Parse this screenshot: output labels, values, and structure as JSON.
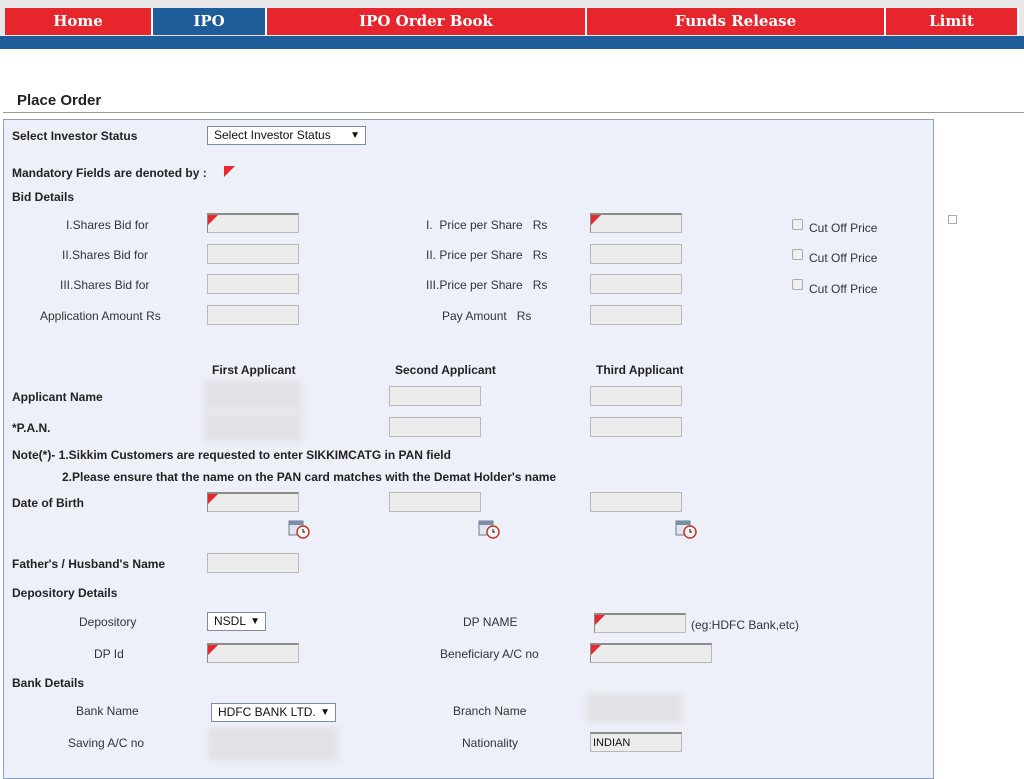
{
  "nav": {
    "items": [
      {
        "label": "Home"
      },
      {
        "label": "IPO"
      },
      {
        "label": "IPO Order Book"
      },
      {
        "label": "Funds Release"
      },
      {
        "label": "Limit"
      }
    ]
  },
  "page": {
    "title": "Place Order"
  },
  "form": {
    "investor_status_label": "Select Investor Status",
    "investor_status_value": "Select Investor Status",
    "mandatory_note": "Mandatory Fields are denoted by :",
    "bid_details": {
      "heading": "Bid Details",
      "shares_bid_1": "I.Shares Bid for",
      "shares_bid_2": "II.Shares Bid for",
      "shares_bid_3": "III.Shares Bid for",
      "application_amount": "Application Amount   Rs",
      "price_1": "I.  Price per Share   Rs",
      "price_2": "II. Price per Share   Rs",
      "price_3": "III.Price per Share   Rs",
      "pay_amount": "Pay Amount   Rs",
      "cutoff_label": "Cut Off Price"
    },
    "applicants": {
      "first": "First Applicant",
      "second": "Second Applicant",
      "third": "Third Applicant",
      "name_label": "Applicant Name",
      "pan_label": "*P.A.N.",
      "note_1": "Note(*)- 1.Sikkim Customers are requested to enter SIKKIMCATG in PAN field",
      "note_2": "2.Please ensure that the name on the PAN card matches with the Demat Holder's name",
      "dob_label": "Date of Birth",
      "father_label": "Father's / Husband's Name"
    },
    "depository": {
      "heading": "Depository Details",
      "depository_label": "Depository",
      "depository_value": "NSDL",
      "dp_id_label": "DP Id",
      "dp_name_label": "DP NAME",
      "dp_name_hint": "(eg:HDFC Bank,etc)",
      "beneficiary_label": "Beneficiary A/C no"
    },
    "bank": {
      "heading": "Bank Details",
      "bank_name_label": "Bank Name",
      "bank_name_value": "HDFC BANK LTD.",
      "saving_label": "Saving A/C no",
      "branch_label": "Branch Name",
      "nationality_label": "Nationality",
      "nationality_value": "INDIAN"
    }
  },
  "icons": {
    "calendar": "calendar-icon",
    "dropdown": "chevron-down-icon",
    "required": "red-corner-flag-icon"
  },
  "colors": {
    "nav_red": "#e6262c",
    "nav_blue": "#1f5c9a",
    "form_bg": "#edf0f8",
    "required_flag": "#e8282c"
  }
}
